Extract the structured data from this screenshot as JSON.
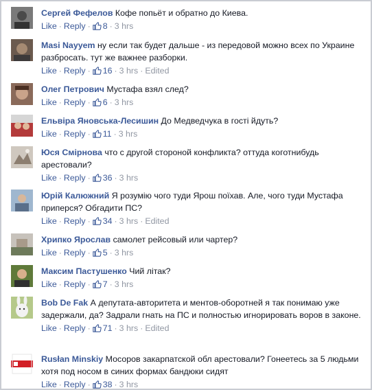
{
  "comments": [
    {
      "author": "Сергей Фефелов",
      "text": "Кофе попьёт и обратно до Киева.",
      "like": "Like",
      "reply": "Reply",
      "likes": "8",
      "time": "3 hrs",
      "edited": ""
    },
    {
      "author": "Masi Nayyem",
      "text": "ну если так будет дальше - из передовой можно всех по Украине разбросать. тут же важнее разборки.",
      "like": "Like",
      "reply": "Reply",
      "likes": "16",
      "time": "3 hrs",
      "edited": "Edited"
    },
    {
      "author": "Олег Петрович",
      "text": "Мустафа взял след?",
      "like": "Like",
      "reply": "Reply",
      "likes": "6",
      "time": "3 hrs",
      "edited": ""
    },
    {
      "author": "Ельвіра Яновська-Лесишин",
      "text": "До Медведчука в гості йдуть?",
      "like": "Like",
      "reply": "Reply",
      "likes": "11",
      "time": "3 hrs",
      "edited": ""
    },
    {
      "author": "Юся Смірнова",
      "text": "что с другой стороной конфликта? оттуда коготнибудь арестовали?",
      "like": "Like",
      "reply": "Reply",
      "likes": "36",
      "time": "3 hrs",
      "edited": ""
    },
    {
      "author": "Юрій Калюжний",
      "text": "Я розумію чого туди Ярош поїхав. Але, чого туди Мустафа приперся? Обгадити ПС?",
      "like": "Like",
      "reply": "Reply",
      "likes": "34",
      "time": "3 hrs",
      "edited": "Edited"
    },
    {
      "author": "Хрипко Ярослав",
      "text": "самолет рейсовый или чартер?",
      "like": "Like",
      "reply": "Reply",
      "likes": "5",
      "time": "3 hrs",
      "edited": ""
    },
    {
      "author": "Максим Пастушенко",
      "text": "Чий літак?",
      "like": "Like",
      "reply": "Reply",
      "likes": "7",
      "time": "3 hrs",
      "edited": ""
    },
    {
      "author": "Bob De Fak",
      "text": "А депутата-авторитета и ментов-оборотней я так понимаю уже задержали, да? Задрали гнать на ПС и полностью игнорировать воров в законе.",
      "like": "Like",
      "reply": "Reply",
      "likes": "71",
      "time": "3 hrs",
      "edited": "Edited"
    },
    {
      "author": "Rusłan Minskiy",
      "text": "Мосоров закарпатской обл арестовали? Гонеетесь за 5 людьми хотя под носом в синих формах бандюки сидят",
      "like": "Like",
      "reply": "Reply",
      "likes": "38",
      "time": "3 hrs",
      "edited": ""
    }
  ],
  "colors": {
    "link": "#3b5998",
    "meta": "#9197a3",
    "text": "#141823",
    "border": "#c9ccd2"
  },
  "icons": {
    "like": "thumbs-up-icon"
  }
}
